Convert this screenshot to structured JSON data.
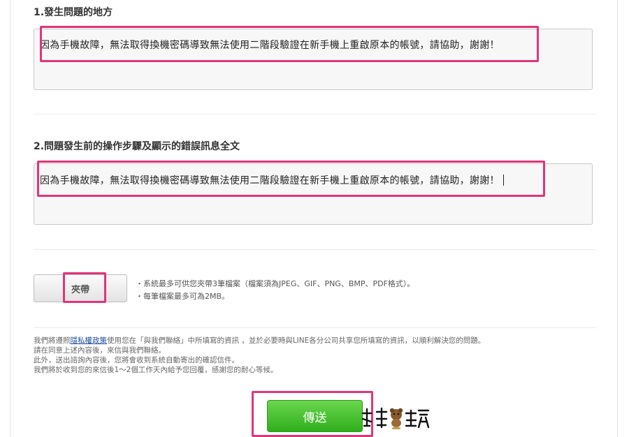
{
  "question1": {
    "label": "1.發生問題的地方",
    "value": "因為手機故障，無法取得換機密碼導致無法使用二階段驗證在新手機上重啟原本的帳號，請協助，謝謝！"
  },
  "question2": {
    "label": "2.問題發生前的操作步驟及顯示的錯誤訊息全文",
    "value": "因為手機故障，無法取得換機密碼導致無法使用二階段驗證在新手機上重啟原本的帳號，請協助，謝謝！"
  },
  "attachment": {
    "button_label": "夾帶",
    "note_1": "・系統最多可供您夾帶3筆檔案（檔案須為JPEG、GIF、PNG、BMP、PDF格式）。",
    "note_2": "・每筆檔案最多可為2MB。"
  },
  "notice": {
    "line1_pre": "我們將遵照",
    "privacy_link": "隱私權政策",
    "line1_post": "使用您在「與我們聯絡」中所填寫的資訊 ，並於必要時與LINE各分公司共享您所填寫的資訊，以順利解決您的問題。",
    "line2": "請在同意上述內容後，來信與我們聯絡。",
    "line3": "此外，送出諮詢內容後，您將會收到系統自動寄出的確認信件。",
    "line4": "我們將於收到您的來信後1～2個工作天內給予您回覆，感謝您的耐心等候。"
  },
  "send_button_label": "傳送",
  "highlight_color": "#e0357a",
  "send_button_color": "#3cbf2a"
}
